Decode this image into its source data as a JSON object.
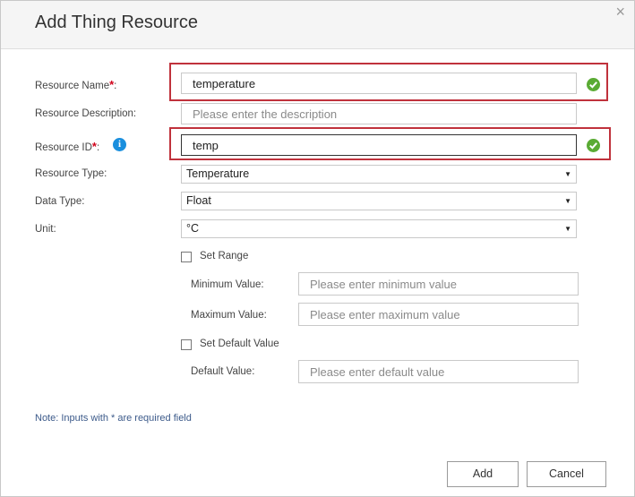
{
  "dialog": {
    "title": "Add Thing Resource",
    "close_glyph": "×"
  },
  "form": {
    "resource_name": {
      "label": "Resource Name",
      "required_mark": "*",
      "suffix": ":",
      "value": "temperature",
      "valid": true
    },
    "resource_description": {
      "label": "Resource Description:",
      "value": "",
      "placeholder": "Please enter the description"
    },
    "resource_id": {
      "label": "Resource ID",
      "required_mark": "*",
      "suffix": ":",
      "value": "temp",
      "info_icon": "info-icon",
      "valid": true
    },
    "resource_type": {
      "label": "Resource Type:",
      "selected": "Temperature"
    },
    "data_type": {
      "label": "Data Type:",
      "selected": "Float"
    },
    "unit": {
      "label": "Unit:",
      "selected": "°C"
    },
    "set_range": {
      "label": "Set Range",
      "checked": false
    },
    "minimum_value": {
      "label": "Minimum Value:",
      "value": "",
      "placeholder": "Please enter minimum value"
    },
    "maximum_value": {
      "label": "Maximum Value:",
      "value": "",
      "placeholder": "Please enter maximum value"
    },
    "set_default_value": {
      "label": "Set Default Value",
      "checked": false
    },
    "default_value": {
      "label": "Default Value:",
      "value": "",
      "placeholder": "Please enter default value"
    }
  },
  "note": "Note: Inputs with * are required field",
  "buttons": {
    "add": "Add",
    "cancel": "Cancel"
  },
  "colors": {
    "highlight_border": "#c0323c",
    "required_mark": "#d0021b",
    "valid_check": "#5aab34",
    "info_icon": "#1a8fde",
    "note_text": "#3c5a8a"
  }
}
